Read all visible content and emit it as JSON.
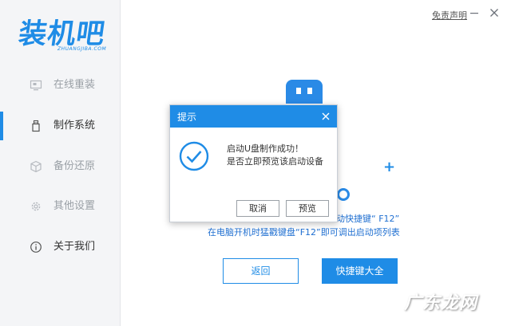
{
  "brand": {
    "logo_text": "装机吧",
    "logo_sub": "ZHUANGJIBA.COM",
    "color": "#1f8ce6"
  },
  "window": {
    "disclaimer": "免责声明",
    "minimize_icon": "minimize-icon",
    "close_icon": "close-icon"
  },
  "sidebar": {
    "items": [
      {
        "label": "在线重装",
        "icon": "monitor-icon",
        "active": false
      },
      {
        "label": "制作系统",
        "icon": "usb-drive-icon",
        "active": true
      },
      {
        "label": "备份还原",
        "icon": "cube-icon",
        "active": false
      },
      {
        "label": "其他设置",
        "icon": "gear-icon",
        "active": false
      },
      {
        "label": "关于我们",
        "icon": "info-icon",
        "active": false
      }
    ]
  },
  "main": {
    "hint_line1_tail": "动快捷键“ F12”",
    "hint_line2": "在电脑开机时猛戳键盘“F12”即可调出启动项列表",
    "back_button": "返回",
    "hotkeys_button": "快捷键大全"
  },
  "dialog": {
    "title": "提示",
    "message_line1": "启动U盘制作成功！",
    "message_line2": "是否立即预览该启动设备",
    "cancel_button": "取消",
    "preview_button": "预览",
    "status_icon": "check-circle-icon"
  },
  "watermark": {
    "text": "广东龙网"
  }
}
